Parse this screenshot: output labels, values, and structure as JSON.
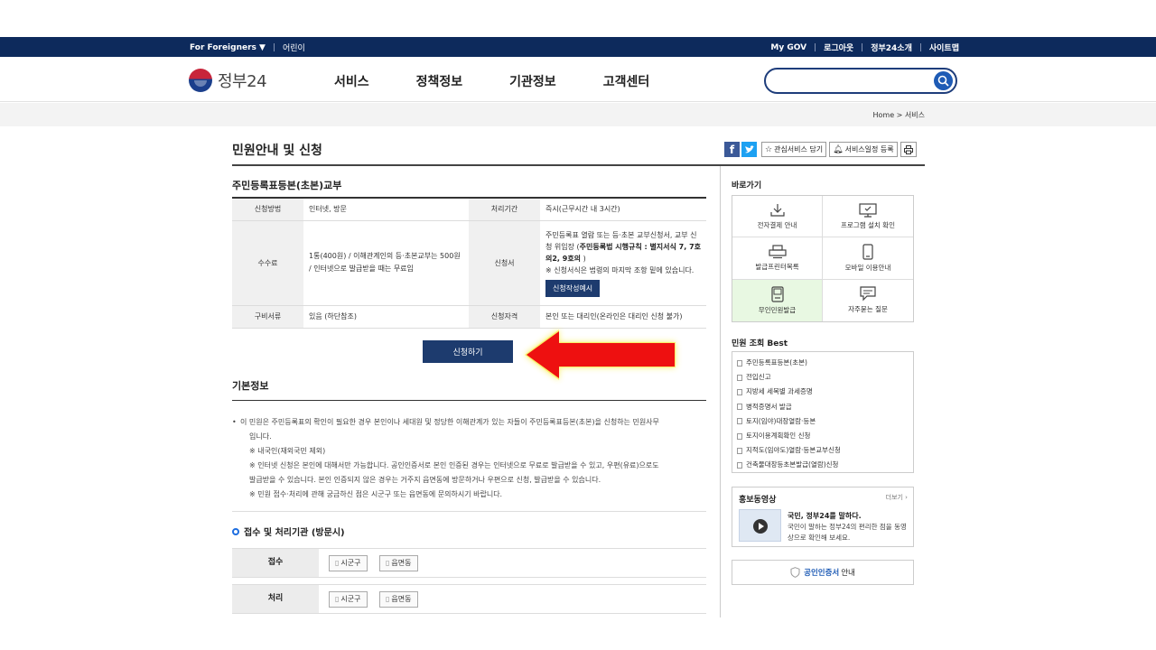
{
  "topbar": {
    "for_foreigners": "For Foreigners ▼",
    "kids": "어린이",
    "mygov": "My GOV",
    "logout": "로그아웃",
    "intro": "정부24소개",
    "sitemap": "사이트맵"
  },
  "header": {
    "logo_text": "정부24",
    "nav": [
      "서비스",
      "정책정보",
      "기관정보",
      "고객센터"
    ],
    "search_placeholder": ""
  },
  "breadcrumb": {
    "home": "Home",
    "sep": ">",
    "current": "서비스"
  },
  "page": {
    "title": "민원안내 및 신청",
    "tools": {
      "interest": "관심서비스 담기",
      "schedule": "서비스일정 등록"
    }
  },
  "service": {
    "name": "주민등록표등본(초본)교부",
    "rows": {
      "method_label": "신청방법",
      "method_value": "인터넷, 방문",
      "period_label": "처리기간",
      "period_value": "즉시(근무시간 내 3시간)",
      "fee_label": "수수료",
      "fee_value": "1통(400원) / 이해관계인의 등·초본교부는 500원 / 인터넷으로 발급받을 때는 무료임",
      "form_label": "신청서",
      "form_value_1": "주민등록표 열람 또는 등·초본 교부신청서, 교부 신청 위임장 (",
      "form_value_bold": "주민등록법 시행규칙 : 별지서식 7, 7호의2, 9호의",
      "form_value_2": " )",
      "form_note": "※ 신청서식은 법령의 마지막 조항 밑에 있습니다.",
      "form_example_button": "신청작성예시",
      "docs_label": "구비서류",
      "docs_value": "있음 (하단참조)",
      "qual_label": "신청자격",
      "qual_value": "본인 또는 대리인(온라인은 대리인 신청 불가)"
    },
    "apply_button": "신청하기"
  },
  "basic": {
    "title": "기본정보",
    "lines": [
      "이 민원은 주민등록표의 확인이 필요한 경우 본인이나 세대원 및 정당한 이해관계가 있는 자들이 주민등록표등본(초본)을 신청하는 민원사무",
      "입니다.",
      "※ 내국인(재외국민 제외)",
      "※ 인터넷 신청은 본인에 대해서만 가능합니다. 공인인증서로 본인 인증된 경우는 인터넷으로 무료로 발급받을 수 있고, 우편(유료)으로도",
      "발급받을 수 있습니다. 본인 인증되지 않은 경우는 거주지 읍면동에 방문하거나 우편으로 신청, 발급받을 수 있습니다.",
      "※ 민원 접수·처리에 관해 궁금하신 점은 시군구 또는 읍면동에 문의하시기 바랍니다."
    ]
  },
  "process": {
    "title": "접수 및 처리기관 (방문시)",
    "rows": [
      {
        "label": "접수",
        "tags": [
          "시군구",
          "읍면동"
        ]
      },
      {
        "label": "처리",
        "tags": [
          "시군구",
          "읍면동"
        ]
      }
    ]
  },
  "sidebar": {
    "quick_title": "바로가기",
    "quick_items": [
      "전자결제 안내",
      "프로그램 설치 확인",
      "발급프린터목록",
      "모바일 이용안내",
      "무인민원발급",
      "자주묻는 질문"
    ],
    "best_title": "민원 조회 Best",
    "best_items": [
      "주민등록표등본(초본)",
      "전입신고",
      "지방세 세목별 과세증명",
      "병적증명서 발급",
      "토지(임야)대장열람·등본",
      "토지이용계획확인 신청",
      "지적도(임야도)열람·등본교부신청",
      "건축물대장등초본발급(열람)신청"
    ],
    "promo": {
      "title": "홍보동영상",
      "more": "더보기 ›",
      "headline": "국민, 정부24를 말하다.",
      "desc": "국민이 말하는 정부24의 편리한 점을 동영상으로 확인해 보세요."
    },
    "cert": {
      "blue": "공인인증서",
      "rest": "안내"
    }
  }
}
